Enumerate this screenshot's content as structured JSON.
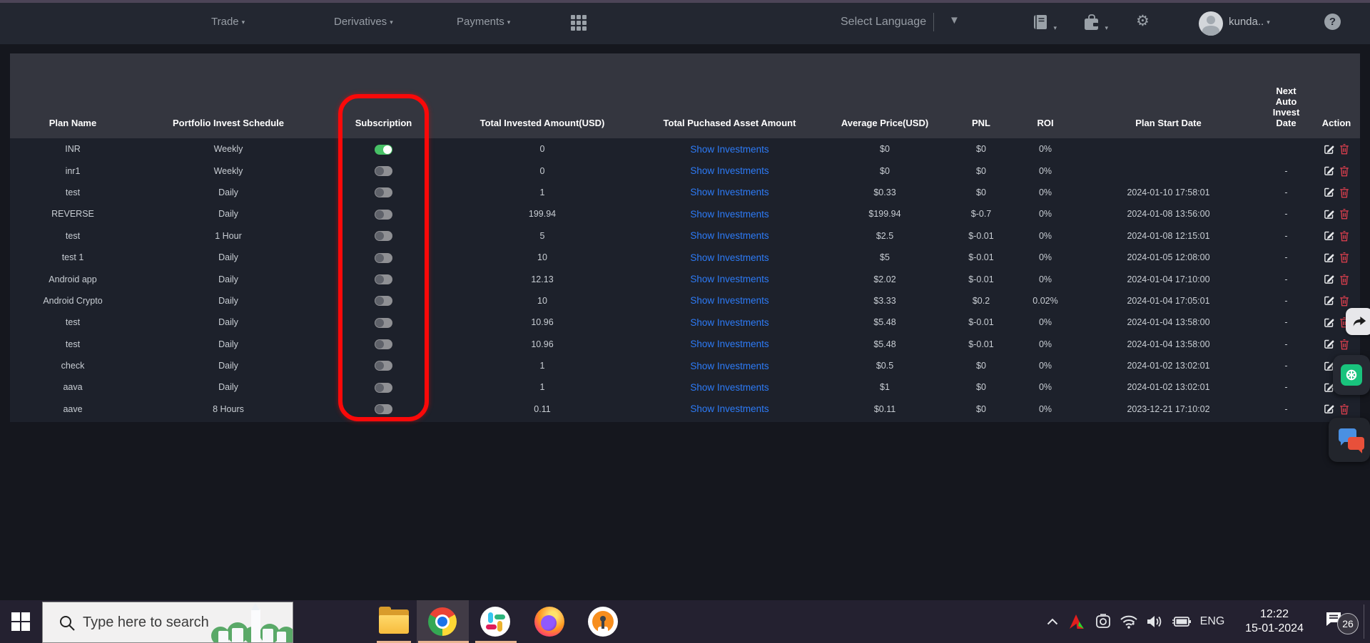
{
  "topbar": {
    "menus": [
      {
        "label": "Trade"
      },
      {
        "label": "Derivatives"
      },
      {
        "label": "Payments"
      }
    ],
    "language_label": "Select Language",
    "user_name": "kunda..",
    "help_label": "?"
  },
  "table": {
    "headers": [
      "Plan Name",
      "Portfolio Invest Schedule",
      "Subscription",
      "Total Invested Amount(USD)",
      "Total Puchased Asset Amount",
      "Average Price(USD)",
      "PNL",
      "ROI",
      "Plan Start Date",
      "Next Auto Invest Date",
      "Action"
    ],
    "show_investments_label": "Show Investments",
    "rows": [
      {
        "plan": "INR",
        "schedule": "Weekly",
        "subscribed": true,
        "invested": "0",
        "avg_price": "$0",
        "pnl": "$0",
        "roi": "0%",
        "start_date": "",
        "next_date": ""
      },
      {
        "plan": "inr1",
        "schedule": "Weekly",
        "subscribed": false,
        "invested": "0",
        "avg_price": "$0",
        "pnl": "$0",
        "roi": "0%",
        "start_date": "",
        "next_date": "-"
      },
      {
        "plan": "test",
        "schedule": "Daily",
        "subscribed": false,
        "invested": "1",
        "avg_price": "$0.33",
        "pnl": "$0",
        "roi": "0%",
        "start_date": "2024-01-10 17:58:01",
        "next_date": "-"
      },
      {
        "plan": "REVERSE",
        "schedule": "Daily",
        "subscribed": false,
        "invested": "199.94",
        "avg_price": "$199.94",
        "pnl": "$-0.7",
        "roi": "0%",
        "start_date": "2024-01-08 13:56:00",
        "next_date": "-"
      },
      {
        "plan": "test",
        "schedule": "1 Hour",
        "subscribed": false,
        "invested": "5",
        "avg_price": "$2.5",
        "pnl": "$-0.01",
        "roi": "0%",
        "start_date": "2024-01-08 12:15:01",
        "next_date": "-"
      },
      {
        "plan": "test 1",
        "schedule": "Daily",
        "subscribed": false,
        "invested": "10",
        "avg_price": "$5",
        "pnl": "$-0.01",
        "roi": "0%",
        "start_date": "2024-01-05 12:08:00",
        "next_date": "-"
      },
      {
        "plan": "Android app",
        "schedule": "Daily",
        "subscribed": false,
        "invested": "12.13",
        "avg_price": "$2.02",
        "pnl": "$-0.01",
        "roi": "0%",
        "start_date": "2024-01-04 17:10:00",
        "next_date": "-"
      },
      {
        "plan": "Android Crypto",
        "schedule": "Daily",
        "subscribed": false,
        "invested": "10",
        "avg_price": "$3.33",
        "pnl": "$0.2",
        "roi": "0.02%",
        "start_date": "2024-01-04 17:05:01",
        "next_date": "-"
      },
      {
        "plan": "test",
        "schedule": "Daily",
        "subscribed": false,
        "invested": "10.96",
        "avg_price": "$5.48",
        "pnl": "$-0.01",
        "roi": "0%",
        "start_date": "2024-01-04 13:58:00",
        "next_date": "-"
      },
      {
        "plan": "test",
        "schedule": "Daily",
        "subscribed": false,
        "invested": "10.96",
        "avg_price": "$5.48",
        "pnl": "$-0.01",
        "roi": "0%",
        "start_date": "2024-01-04 13:58:00",
        "next_date": "-"
      },
      {
        "plan": "check",
        "schedule": "Daily",
        "subscribed": false,
        "invested": "1",
        "avg_price": "$0.5",
        "pnl": "$0",
        "roi": "0%",
        "start_date": "2024-01-02 13:02:01",
        "next_date": "-"
      },
      {
        "plan": "aava",
        "schedule": "Daily",
        "subscribed": false,
        "invested": "1",
        "avg_price": "$1",
        "pnl": "$0",
        "roi": "0%",
        "start_date": "2024-01-02 13:02:01",
        "next_date": "-"
      },
      {
        "plan": "aave",
        "schedule": "8 Hours",
        "subscribed": false,
        "invested": "0.11",
        "avg_price": "$0.11",
        "pnl": "$0",
        "roi": "0%",
        "start_date": "2023-12-21 17:10:02",
        "next_date": "-"
      }
    ]
  },
  "annotation": {
    "highlighted_column": "Subscription",
    "color": "#fa0909"
  },
  "taskbar": {
    "search_placeholder": "Type here to search",
    "language_indicator": "ENG",
    "time": "12:22",
    "date": "15-01-2024",
    "notification_count": "26"
  }
}
